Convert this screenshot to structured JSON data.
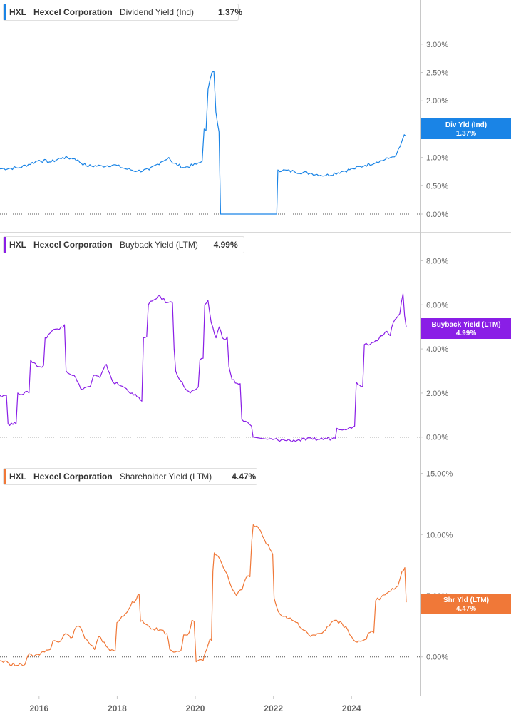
{
  "chart_data": [
    {
      "type": "line",
      "ticker": "HXL",
      "company": "Hexcel Corporation",
      "metric": "Dividend Yield (Ind)",
      "current_value": "1.37%",
      "badge_label": "Div Yld (Ind)",
      "badge_value": "1.37%",
      "color": "#1a84e6",
      "ylim": [
        0,
        3.3
      ],
      "ticks": [
        0,
        0.5,
        1,
        1.5,
        2,
        2.5,
        3
      ],
      "tick_labels": [
        "0.00%",
        "0.50%",
        "1.00%",
        "1.50%",
        "2.00%",
        "2.50%",
        "3.00%"
      ],
      "points": [
        [
          2015.0,
          0.8
        ],
        [
          2015.5,
          0.82
        ],
        [
          2016.0,
          0.95
        ],
        [
          2016.3,
          0.92
        ],
        [
          2016.6,
          1.0
        ],
        [
          2016.9,
          0.98
        ],
        [
          2017.2,
          0.85
        ],
        [
          2017.6,
          0.85
        ],
        [
          2017.9,
          0.87
        ],
        [
          2018.2,
          0.8
        ],
        [
          2018.5,
          0.76
        ],
        [
          2018.8,
          0.78
        ],
        [
          2019.1,
          0.92
        ],
        [
          2019.3,
          1.0
        ],
        [
          2019.4,
          0.9
        ],
        [
          2019.7,
          0.82
        ],
        [
          2020.0,
          0.88
        ],
        [
          2020.15,
          0.93
        ],
        [
          2020.2,
          1.5
        ],
        [
          2020.3,
          2.2
        ],
        [
          2020.4,
          2.5
        ],
        [
          2020.5,
          1.8
        ],
        [
          2020.58,
          1.45
        ],
        [
          2020.62,
          0.0
        ],
        [
          2022.05,
          0.0
        ],
        [
          2022.08,
          0.78
        ],
        [
          2022.5,
          0.75
        ],
        [
          2022.9,
          0.72
        ],
        [
          2023.3,
          0.68
        ],
        [
          2023.7,
          0.75
        ],
        [
          2024.0,
          0.8
        ],
        [
          2024.3,
          0.86
        ],
        [
          2024.6,
          0.92
        ],
        [
          2024.9,
          0.98
        ],
        [
          2025.1,
          1.05
        ],
        [
          2025.2,
          1.2
        ],
        [
          2025.3,
          1.4
        ],
        [
          2025.35,
          1.37
        ]
      ]
    },
    {
      "type": "line",
      "ticker": "HXL",
      "company": "Hexcel Corporation",
      "metric": "Buyback Yield (LTM)",
      "current_value": "4.99%",
      "badge_label": "Buyback Yield (LTM)",
      "badge_value": "4.99%",
      "color": "#8a1ee6",
      "ylim": [
        -0.3,
        8.5
      ],
      "ticks": [
        0,
        2,
        4,
        6,
        8
      ],
      "tick_labels": [
        "0.00%",
        "2.00%",
        "4.00%",
        "6.00%",
        "8.00%"
      ],
      "points": [
        [
          2015.0,
          1.9
        ],
        [
          2015.2,
          1.9
        ],
        [
          2015.25,
          0.6
        ],
        [
          2015.5,
          0.6
        ],
        [
          2015.55,
          2.0
        ],
        [
          2015.9,
          2.0
        ],
        [
          2015.95,
          3.5
        ],
        [
          2016.2,
          3.2
        ],
        [
          2016.4,
          4.5
        ],
        [
          2016.6,
          4.8
        ],
        [
          2016.9,
          5.0
        ],
        [
          2017.0,
          5.1
        ],
        [
          2017.05,
          3.0
        ],
        [
          2017.3,
          2.8
        ],
        [
          2017.5,
          2.2
        ],
        [
          2017.8,
          2.3
        ],
        [
          2017.9,
          2.8
        ],
        [
          2018.1,
          2.7
        ],
        [
          2018.3,
          3.3
        ],
        [
          2018.5,
          2.5
        ],
        [
          2018.8,
          2.3
        ],
        [
          2019.1,
          2.0
        ],
        [
          2019.35,
          1.7
        ],
        [
          2019.45,
          4.5
        ],
        [
          2019.6,
          6.0
        ],
        [
          2019.9,
          6.4
        ],
        [
          2020.2,
          6.1
        ],
        [
          2020.4,
          4.0
        ],
        [
          2020.45,
          3.0
        ],
        [
          2020.7,
          2.3
        ],
        [
          2020.9,
          2.0
        ],
        [
          2021.1,
          2.2
        ],
        [
          2021.2,
          3.5
        ],
        [
          2021.35,
          6.0
        ],
        [
          2021.45,
          6.2
        ],
        [
          2021.55,
          5.2
        ],
        [
          2021.7,
          4.5
        ],
        [
          2021.8,
          5.0
        ],
        [
          2021.9,
          4.5
        ],
        [
          2022.1,
          3.2
        ],
        [
          2022.2,
          2.6
        ],
        [
          2022.4,
          2.4
        ],
        [
          2022.5,
          0.8
        ],
        [
          2022.8,
          0.5
        ],
        [
          2022.85,
          0.0
        ],
        [
          2023.3,
          -0.1
        ],
        [
          2024.0,
          -0.15
        ],
        [
          2024.7,
          -0.1
        ],
        [
          2025.4,
          -0.05
        ],
        [
          2025.45,
          0.4
        ],
        [
          2025.9,
          0.4
        ],
        [
          2026.0,
          0.5
        ],
        [
          2026.05,
          2.5
        ],
        [
          2026.25,
          2.3
        ],
        [
          2026.3,
          4.2
        ],
        [
          2026.6,
          4.3
        ],
        [
          2026.8,
          4.6
        ],
        [
          2027.0,
          4.8
        ],
        [
          2027.1,
          4.6
        ],
        [
          2027.2,
          5.2
        ],
        [
          2027.3,
          5.4
        ],
        [
          2027.4,
          5.6
        ],
        [
          2027.5,
          6.5
        ],
        [
          2027.55,
          5.5
        ],
        [
          2027.6,
          4.99
        ]
      ]
    },
    {
      "type": "line",
      "ticker": "HXL",
      "company": "Hexcel Corporation",
      "metric": "Shareholder Yield (LTM)",
      "current_value": "4.47%",
      "badge_label": "Shr Yld (LTM)",
      "badge_value": "4.47%",
      "color": "#f07838",
      "ylim": [
        -2.0,
        15.5
      ],
      "ticks": [
        0,
        5,
        10,
        15
      ],
      "tick_labels": [
        "0.00%",
        "5.00%",
        "10.00%",
        "15.00%"
      ],
      "points": [
        [
          2015.0,
          -0.3
        ],
        [
          2015.3,
          -0.5
        ],
        [
          2015.6,
          -0.7
        ],
        [
          2015.9,
          -0.6
        ],
        [
          2016.0,
          0.1
        ],
        [
          2016.3,
          0.2
        ],
        [
          2016.6,
          0.4
        ],
        [
          2016.8,
          0.6
        ],
        [
          2016.9,
          1.3
        ],
        [
          2017.1,
          1.2
        ],
        [
          2017.3,
          1.8
        ],
        [
          2017.6,
          1.6
        ],
        [
          2017.75,
          2.5
        ],
        [
          2017.9,
          2.4
        ],
        [
          2018.05,
          1.5
        ],
        [
          2018.25,
          1.0
        ],
        [
          2018.4,
          0.6
        ],
        [
          2018.55,
          1.7
        ],
        [
          2018.75,
          1.2
        ],
        [
          2018.95,
          0.5
        ],
        [
          2019.2,
          2.8
        ],
        [
          2019.5,
          3.5
        ],
        [
          2019.75,
          4.5
        ],
        [
          2019.9,
          4.7
        ],
        [
          2020.0,
          5.1
        ],
        [
          2020.05,
          2.9
        ],
        [
          2020.3,
          2.6
        ],
        [
          2020.5,
          2.3
        ],
        [
          2020.8,
          2.2
        ],
        [
          2021.0,
          1.9
        ],
        [
          2021.1,
          0.6
        ],
        [
          2021.3,
          0.4
        ],
        [
          2021.5,
          0.5
        ],
        [
          2021.6,
          1.8
        ],
        [
          2021.8,
          2.0
        ],
        [
          2021.9,
          3.0
        ],
        [
          2022.05,
          -0.4
        ],
        [
          2022.3,
          -0.3
        ],
        [
          2022.55,
          1.5
        ],
        [
          2022.65,
          7.0
        ],
        [
          2022.7,
          8.5
        ],
        [
          2022.9,
          8.0
        ],
        [
          2023.1,
          7.0
        ],
        [
          2023.3,
          5.8
        ],
        [
          2023.5,
          5.0
        ],
        [
          2023.7,
          5.5
        ],
        [
          2023.85,
          6.5
        ],
        [
          2024.05,
          9.5
        ],
        [
          2024.1,
          10.8
        ],
        [
          2024.3,
          10.5
        ],
        [
          2024.5,
          9.6
        ],
        [
          2024.7,
          8.8
        ],
        [
          2024.8,
          8.4
        ],
        [
          2024.85,
          4.8
        ],
        [
          2025.0,
          3.7
        ],
        [
          2025.2,
          3.3
        ],
        [
          2025.5,
          3.0
        ],
        [
          2025.7,
          2.8
        ],
        [
          2025.9,
          2.2
        ],
        [
          2026.1,
          1.8
        ],
        [
          2026.4,
          1.9
        ],
        [
          2026.7,
          2.2
        ],
        [
          2026.9,
          2.8
        ],
        [
          2027.1,
          3.0
        ],
        [
          2027.3,
          2.7
        ],
        [
          2027.5,
          2.2
        ],
        [
          2027.7,
          1.4
        ],
        [
          2027.9,
          1.3
        ],
        [
          2028.1,
          1.4
        ],
        [
          2028.3,
          2.0
        ],
        [
          2028.5,
          4.6
        ],
        [
          2028.7,
          4.9
        ],
        [
          2028.9,
          5.2
        ],
        [
          2029.1,
          5.6
        ],
        [
          2029.3,
          5.8
        ],
        [
          2029.45,
          7.0
        ],
        [
          2029.55,
          7.3
        ],
        [
          2029.6,
          4.47
        ]
      ]
    }
  ],
  "x_axis": {
    "range": [
      2015.0,
      2025.4
    ],
    "ticks": [
      2016,
      2018,
      2020,
      2022,
      2024
    ],
    "labels": [
      "2016",
      "2018",
      "2020",
      "2022",
      "2024"
    ]
  }
}
